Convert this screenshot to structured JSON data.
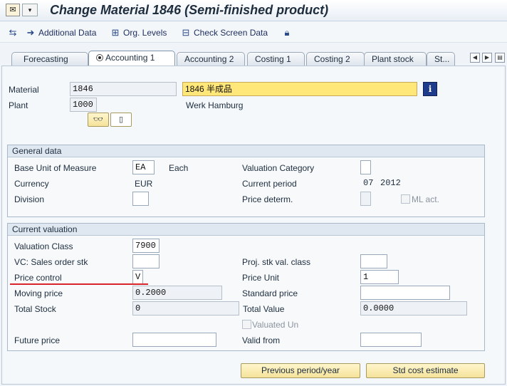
{
  "window": {
    "title": "Change Material 1846 (Semi-finished product)"
  },
  "toolbar": {
    "additional_data": "Additional Data",
    "org_levels": "Org. Levels",
    "check_screen_data": "Check Screen Data"
  },
  "tabs": [
    "Forecasting",
    "Accounting 1",
    "Accounting 2",
    "Costing 1",
    "Costing 2",
    "Plant stock",
    "St..."
  ],
  "active_tab": "Accounting 1",
  "header": {
    "material_label": "Material",
    "material_value": "1846",
    "description": "1846 半成品",
    "plant_label": "Plant",
    "plant_value": "1000",
    "plant_name": "Werk Hamburg"
  },
  "general": {
    "title": "General data",
    "base_uom_label": "Base Unit of Measure",
    "base_uom_value": "EA",
    "base_uom_text": "Each",
    "valuation_category_label": "Valuation Category",
    "currency_label": "Currency",
    "currency_value": "EUR",
    "current_period_label": "Current period",
    "period_month": "07",
    "period_year": "2012",
    "division_label": "Division",
    "price_determ_label": "Price determ.",
    "ml_act_label": "ML act."
  },
  "valuation": {
    "title": "Current valuation",
    "valuation_class_label": "Valuation Class",
    "valuation_class_value": "7900",
    "vc_sales_label": "VC: Sales order stk",
    "proj_stk_label": "Proj. stk val. class",
    "price_control_label": "Price control",
    "price_control_value": "V",
    "price_unit_label": "Price Unit",
    "price_unit_value": "1",
    "moving_price_label": "Moving price",
    "moving_price_value": "0.2000",
    "standard_price_label": "Standard price",
    "total_stock_label": "Total Stock",
    "total_stock_value": "0",
    "total_value_label": "Total Value",
    "total_value_value": "0.0000",
    "valuated_un_label": "Valuated Un",
    "future_price_label": "Future price",
    "valid_from_label": "Valid from"
  },
  "buttons": {
    "previous_period": "Previous period/year",
    "std_cost_estimate": "Std cost estimate"
  },
  "icons": {
    "title_app": "sap-menu-icon",
    "additional_data": "arrow-right-icon",
    "org_levels": "org-hierarchy-icon",
    "check_screen": "check-screen-icon",
    "lock": "lock-icon",
    "info": "info-icon"
  },
  "colors": {
    "highlight_field": "#ffe77a",
    "red_underline": "#d9242b",
    "button_bg": "#f5e29a"
  }
}
